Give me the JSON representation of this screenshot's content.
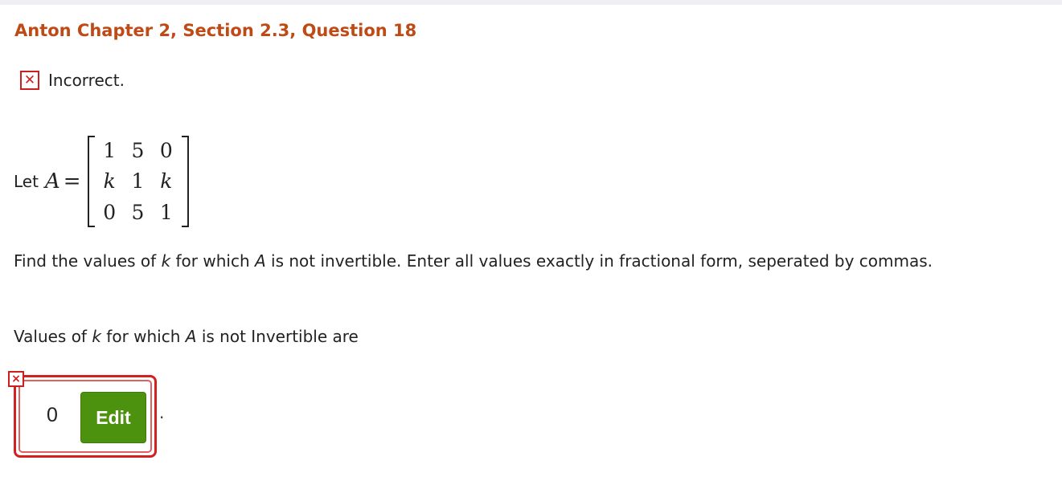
{
  "header": {
    "title": "Anton Chapter 2, Section 2.3, Question 18"
  },
  "status": {
    "icon": "incorrect-x-icon",
    "text": "Incorrect."
  },
  "matrix_prompt": {
    "let": "Let",
    "variable": "A",
    "equals": "=",
    "rows": [
      [
        "1",
        "5",
        "0"
      ],
      [
        "k",
        "1",
        "k"
      ],
      [
        "0",
        "5",
        "1"
      ]
    ]
  },
  "question": {
    "part1": "Find the values of ",
    "var_k": "k",
    "part2": " for which ",
    "var_a": "A",
    "part3": " is not invertible. Enter all values exactly in fractional form, seperated by commas."
  },
  "answer_label": {
    "part1": "Values of ",
    "var_k": "k",
    "part2": " for which ",
    "var_a": "A",
    "part3": " is not Invertible are"
  },
  "answer": {
    "value": "0",
    "edit_label": "Edit",
    "trailing": ".",
    "error_icon": "×"
  },
  "colors": {
    "title": "#bf4a16",
    "error": "#cc1f1f",
    "edit_button": "#4d920f"
  }
}
